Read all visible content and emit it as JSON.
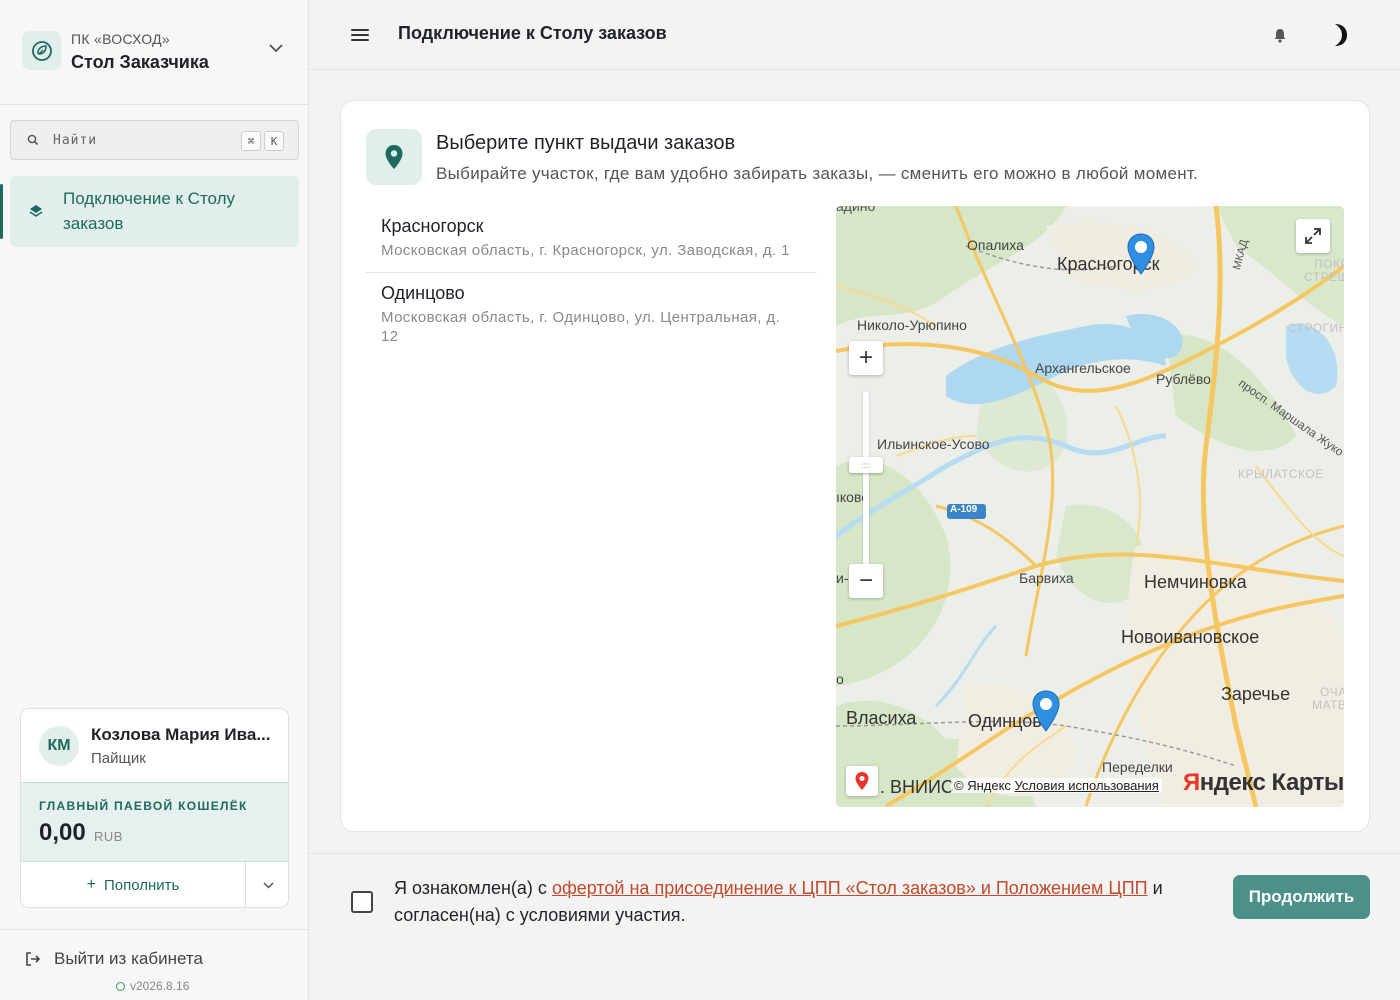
{
  "org": {
    "subtitle": "ПК «ВОСХОД»",
    "name": "Стол Заказчика"
  },
  "search": {
    "placeholder": "Найти",
    "shortcut_1": "⌘",
    "shortcut_2": "K"
  },
  "sidebar": {
    "items": [
      {
        "label": "Подключение к Столу заказов",
        "active": true
      }
    ]
  },
  "user": {
    "initials": "КМ",
    "name": "Козлова Мария Ива...",
    "role": "Пайщик"
  },
  "wallet": {
    "title": "ГЛАВНЫЙ ПАЕВОЙ КОШЕЛЁК",
    "amount": "0,00",
    "currency": "RUB",
    "topup_label": "Пополнить"
  },
  "logout": {
    "label": "Выйти из кабинета",
    "version": "v2026.8.16"
  },
  "header": {
    "title": "Подключение к Столу заказов"
  },
  "card": {
    "title": "Выберите пункт выдачи заказов",
    "subtitle": "Выбирайте участок, где вам удобно забирать заказы, — сменить его можно в любой момент."
  },
  "pickup_points": [
    {
      "name": "Красногорск",
      "address": "Московская область, г. Красногорск, ул. Заводская, д. 1"
    },
    {
      "name": "Одинцово",
      "address": "Московская область, г. Одинцово, ул. Центральная, д. 12"
    }
  ],
  "map": {
    "labels": {
      "krasnogorsk": "Красногорск",
      "odintsovo": "Одинцово",
      "opalikha": "Опалиха",
      "nikolo": "Николо-Урюпино",
      "arkhangelskoe": "Архангельское",
      "rublevo": "Рублёво",
      "ilinskoe": "Ильинское-Усово",
      "barvikha": "Барвиха",
      "nemchinovka": "Немчиновка",
      "novoivanovskoe": "Новоивановское",
      "zarechye": "Заречье",
      "vlasikha": "Власиха",
      "peredelki": "Переделки",
      "vniis": ". ВНИИС",
      "strogino": "СТРОГИНО",
      "krylatskoe": "КРЫЛАТСКОЕ",
      "pokrov": "ПОКРО",
      "strech": "СТРЕЩ",
      "mkad": "МКАД",
      "a109": "А-109",
      "prosp": "просп. Маршала Жуко",
      "ikovo": "ıково",
      "top_cut": "адино",
      "ocha": "ОЧА",
      "matv": "МАТВ",
      "left_cut1": "и-",
      "left_cut2": "о"
    },
    "zoom_in": "+",
    "zoom_out": "−",
    "handle": "::::",
    "copyright": "© Яндекс",
    "terms": "Условия использования",
    "logo_y": "Я",
    "logo_rest": "ндекс Карты"
  },
  "footer": {
    "agree_prefix": "Я ознакомлен(а) с ",
    "agree_link": "офертой на присоединение к ЦПП «Стол заказов» и Положением ЦПП",
    "agree_suffix": " и согласен(на) с условиями участия.",
    "continue_label": "Продолжить"
  },
  "colors": {
    "accent": "#1d6a5e",
    "button": "#4b9189",
    "link": "#c14a2a",
    "map_pin": "#2f8ee0"
  }
}
